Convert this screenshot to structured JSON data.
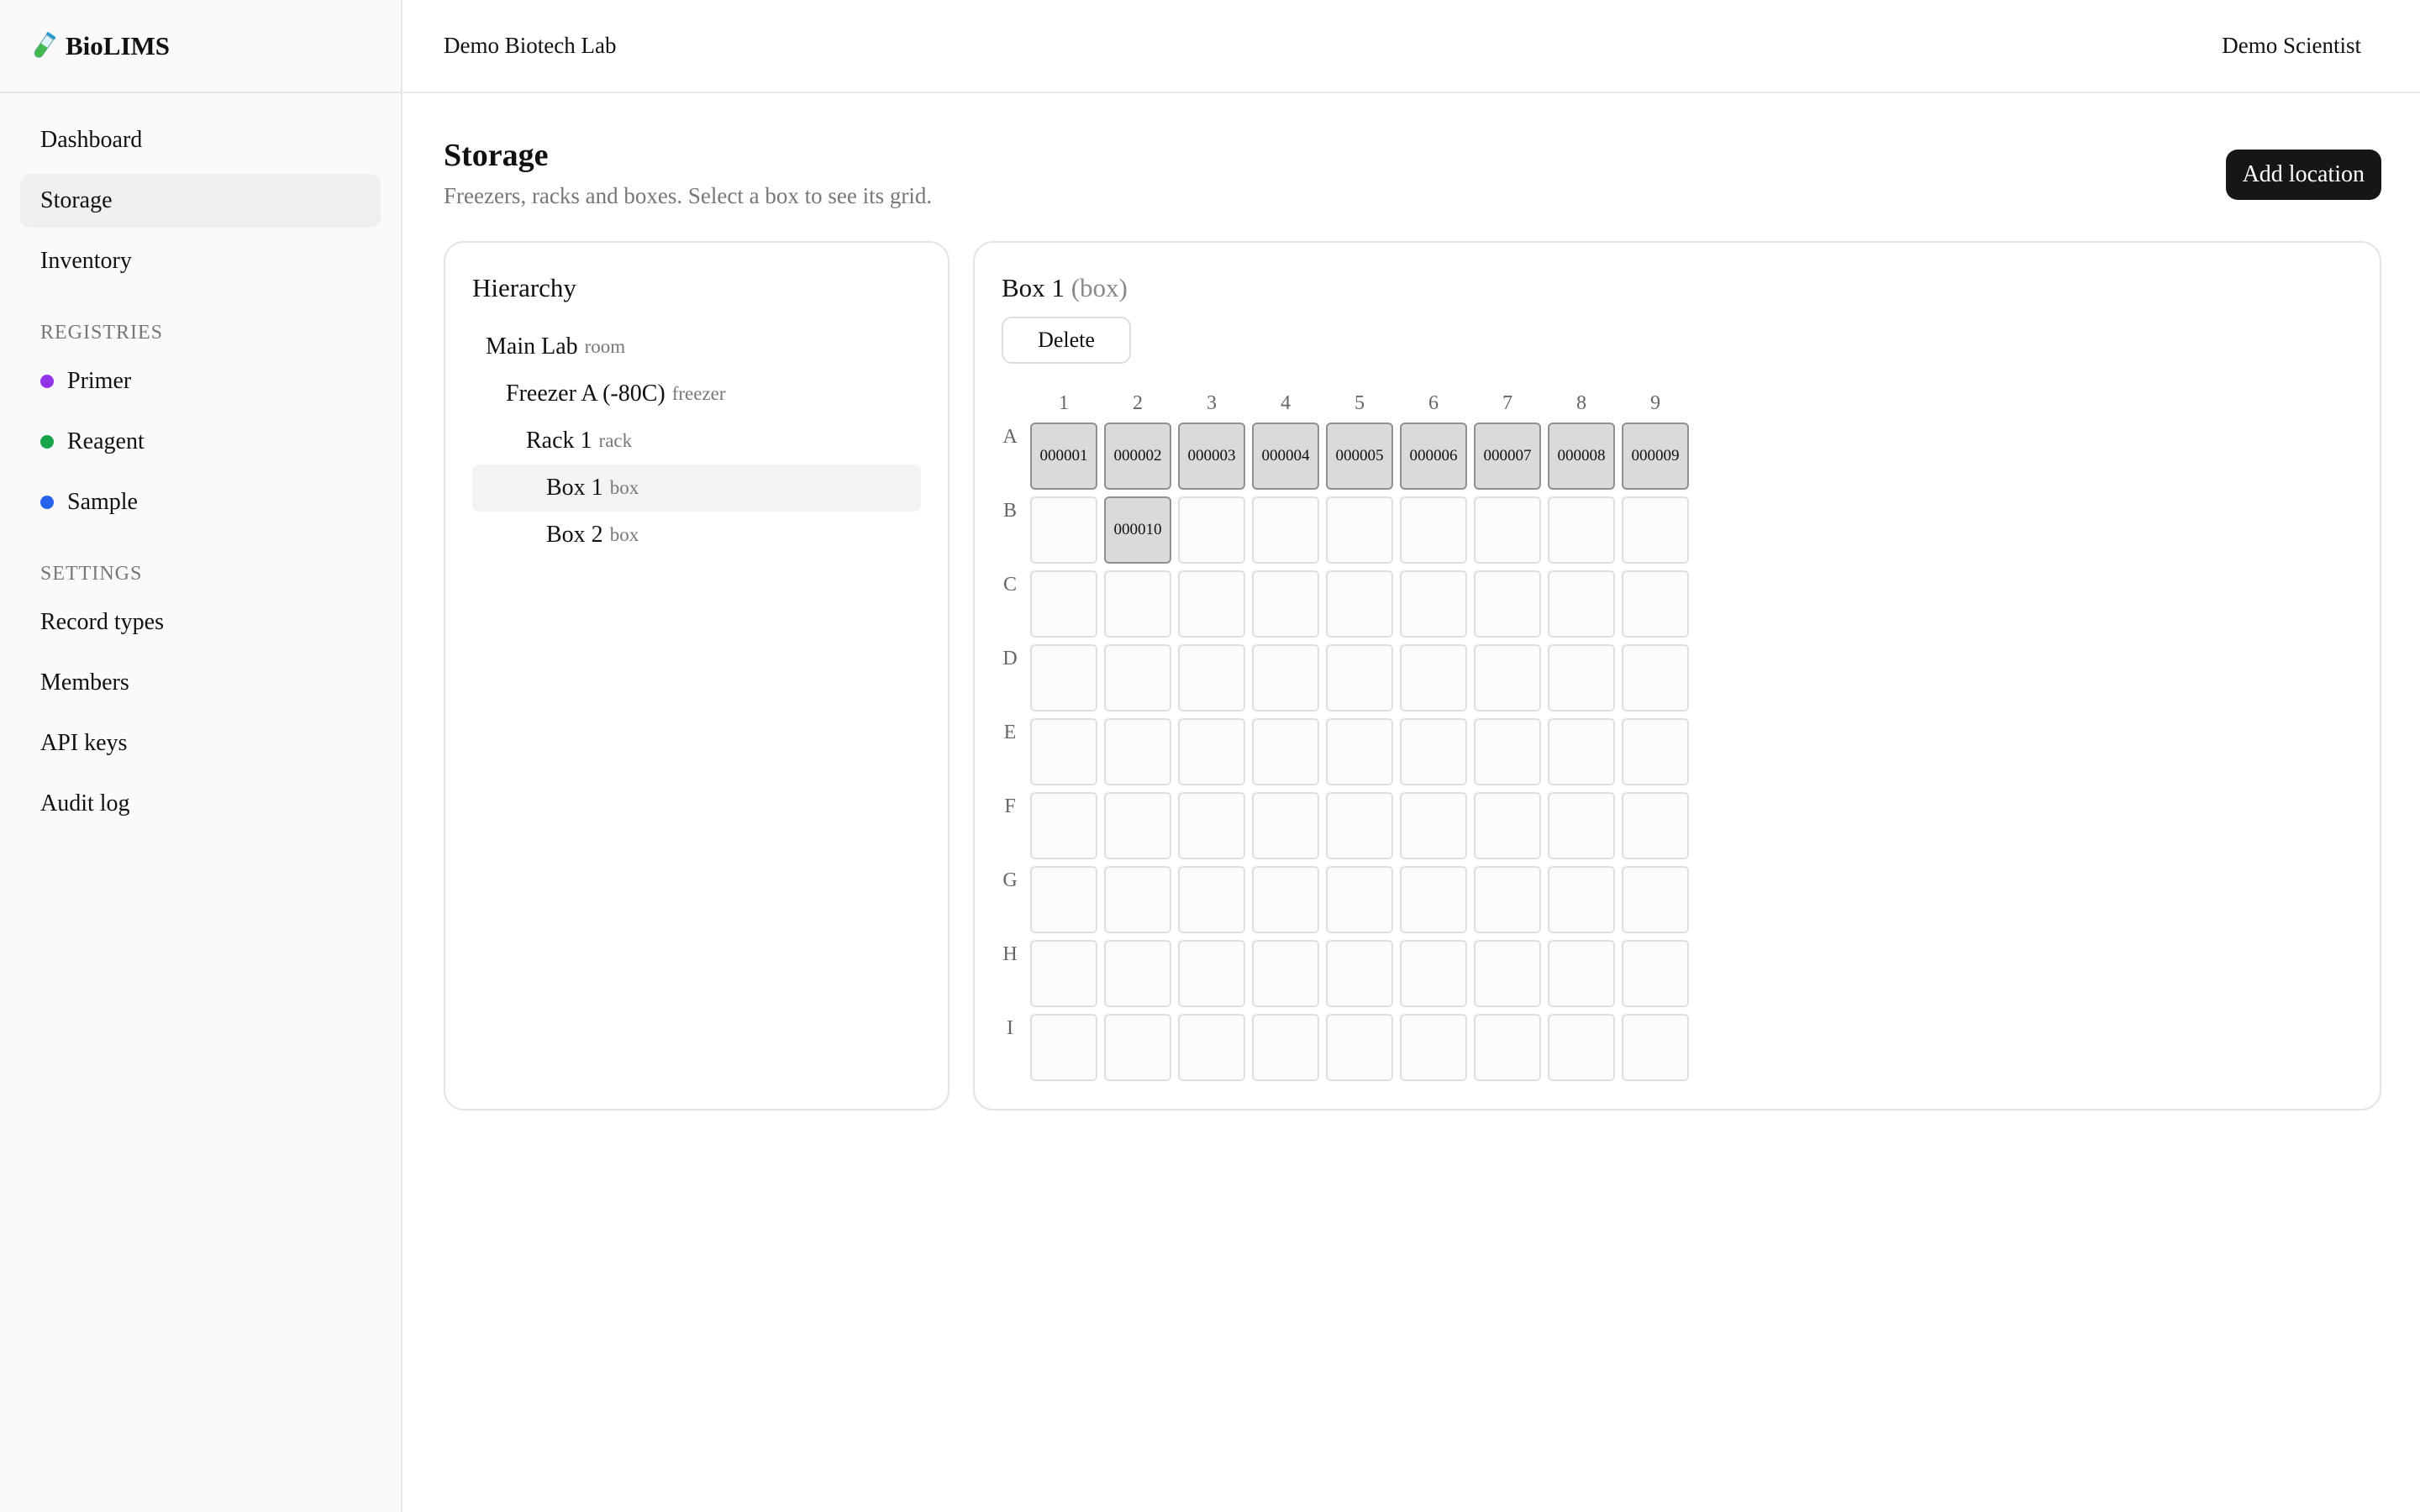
{
  "app": {
    "brand": "BioLIMS",
    "org": "Demo Biotech Lab",
    "user": "Demo Scientist"
  },
  "sidebar": {
    "nav": [
      {
        "label": "Dashboard",
        "active": false
      },
      {
        "label": "Storage",
        "active": true
      },
      {
        "label": "Inventory",
        "active": false
      }
    ],
    "registries_title": "REGISTRIES",
    "registries": [
      {
        "label": "Primer",
        "color": "#9333ea"
      },
      {
        "label": "Reagent",
        "color": "#16a34a"
      },
      {
        "label": "Sample",
        "color": "#2563eb"
      }
    ],
    "settings_title": "SETTINGS",
    "settings": [
      {
        "label": "Record types"
      },
      {
        "label": "Members"
      },
      {
        "label": "API keys"
      },
      {
        "label": "Audit log"
      }
    ]
  },
  "page": {
    "title": "Storage",
    "subtitle": "Freezers, racks and boxes. Select a box to see its grid.",
    "add_button": "Add location"
  },
  "hierarchy": {
    "title": "Hierarchy",
    "nodes": [
      {
        "name": "Main Lab",
        "kind": "room",
        "depth": 0,
        "selected": false
      },
      {
        "name": "Freezer A (-80C)",
        "kind": "freezer",
        "depth": 1,
        "selected": false
      },
      {
        "name": "Rack 1",
        "kind": "rack",
        "depth": 2,
        "selected": false
      },
      {
        "name": "Box 1",
        "kind": "box",
        "depth": 3,
        "selected": true
      },
      {
        "name": "Box 2",
        "kind": "box",
        "depth": 3,
        "selected": false
      }
    ]
  },
  "box": {
    "name": "Box 1",
    "kind": "(box)",
    "delete_label": "Delete",
    "columns": [
      "1",
      "2",
      "3",
      "4",
      "5",
      "6",
      "7",
      "8",
      "9"
    ],
    "rows": [
      "A",
      "B",
      "C",
      "D",
      "E",
      "F",
      "G",
      "H",
      "I"
    ],
    "cells": [
      [
        "000001",
        "000002",
        "000003",
        "000004",
        "000005",
        "000006",
        "000007",
        "000008",
        "000009"
      ],
      [
        "",
        "000010",
        "",
        "",
        "",
        "",
        "",
        "",
        ""
      ],
      [
        "",
        "",
        "",
        "",
        "",
        "",
        "",
        "",
        ""
      ],
      [
        "",
        "",
        "",
        "",
        "",
        "",
        "",
        "",
        ""
      ],
      [
        "",
        "",
        "",
        "",
        "",
        "",
        "",
        "",
        ""
      ],
      [
        "",
        "",
        "",
        "",
        "",
        "",
        "",
        "",
        ""
      ],
      [
        "",
        "",
        "",
        "",
        "",
        "",
        "",
        "",
        ""
      ],
      [
        "",
        "",
        "",
        "",
        "",
        "",
        "",
        "",
        ""
      ],
      [
        "",
        "",
        "",
        "",
        "",
        "",
        "",
        "",
        ""
      ]
    ]
  }
}
